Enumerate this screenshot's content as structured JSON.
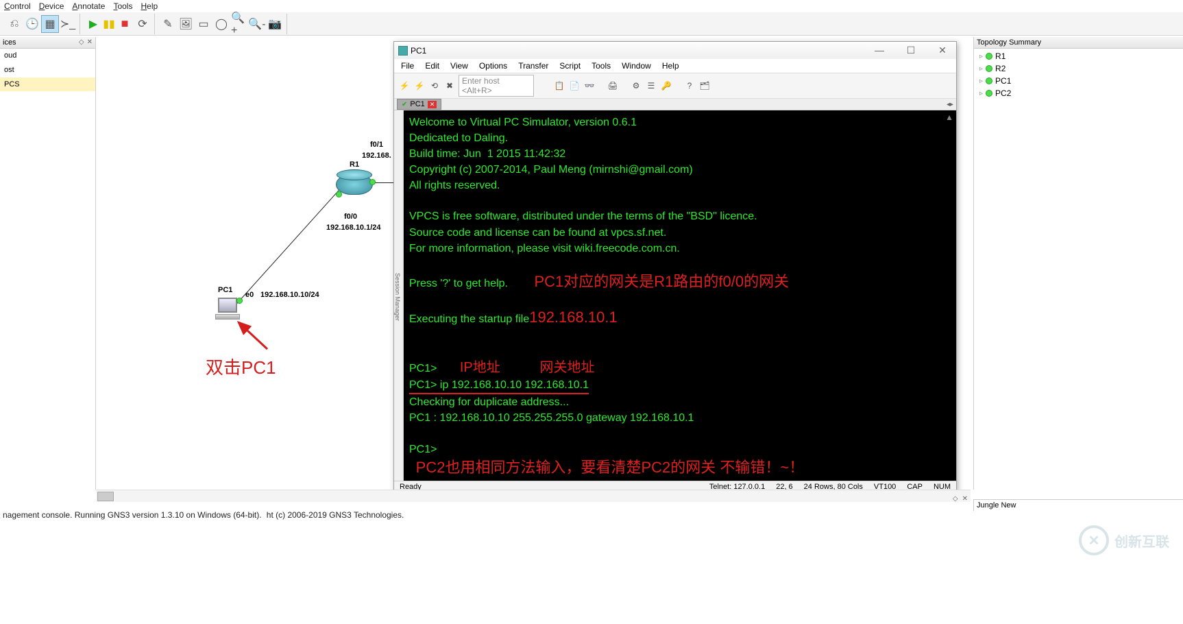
{
  "main_menu": [
    "Control",
    "Device",
    "Annotate",
    "Tools",
    "Help"
  ],
  "devices_panel": {
    "title": "ices",
    "items": [
      "oud",
      "ost",
      "PCS"
    ],
    "selected_index": 2
  },
  "topology": {
    "title": "Topology Summary",
    "items": [
      "R1",
      "R2",
      "PC1",
      "PC2"
    ]
  },
  "jungle_label": "Jungle New",
  "canvas": {
    "r1_label": "R1",
    "pc1_label": "PC1",
    "f01": "f0/1",
    "f01_sub": "192.168.",
    "f00": "f0/0",
    "f00_sub": "192.168.10.1/24",
    "e0": "e0",
    "e0_sub": "192.168.10.10/24",
    "red_annot": "双击PC1"
  },
  "terminal": {
    "title": "PC1",
    "menu": [
      "File",
      "Edit",
      "View",
      "Options",
      "Transfer",
      "Script",
      "Tools",
      "Window",
      "Help"
    ],
    "host_placeholder": "Enter host <Alt+R>",
    "tab_label": "PC1",
    "session_side": "Session Manager",
    "body": {
      "l1": "Welcome to Virtual PC Simulator, version 0.6.1",
      "l2": "Dedicated to Daling.",
      "l3": "Build time: Jun  1 2015 11:42:32",
      "l4": "Copyright (c) 2007-2014, Paul Meng (mirnshi@gmail.com)",
      "l5": "All rights reserved.",
      "l6": "VPCS is free software, distributed under the terms of the \"BSD\" licence.",
      "l7": "Source code and license can be found at vpcs.sf.net.",
      "l8": "For more information, please visit wiki.freecode.com.cn.",
      "l9": "Press '?' to get help.",
      "red_gw": "PC1对应的网关是R1路由的f0/0的网关",
      "l10a": "Executing the startup file",
      "l10b": "192.168.10.1",
      "prompt1": "PC1> ",
      "ipaddr_label": "IP地址",
      "gw_label": "网关地址",
      "cmd_line": "PC1> ip 192.168.10.10 192.168.10.1",
      "l11": "Checking for duplicate address...",
      "l12": "PC1 : 192.168.10.10 255.255.255.0 gateway 192.168.10.1",
      "prompt2": "PC1>",
      "bottom_red": "PC2也用相同方法输入，要看清楚PC2的网关 不输错！~！"
    },
    "status": {
      "ready": "Ready",
      "telnet": "Telnet: 127.0.0.1",
      "pos": "22,  6",
      "size": "24 Rows, 80 Cols",
      "term": "VT100",
      "caps": "CAP",
      "num": "NUM"
    }
  },
  "footer": {
    "line1": "nagement console. Running GNS3 version 1.3.10 on Windows (64-bit).",
    "line2": "ht (c) 2006-2019 GNS3 Technologies."
  },
  "watermark": "创新互联"
}
